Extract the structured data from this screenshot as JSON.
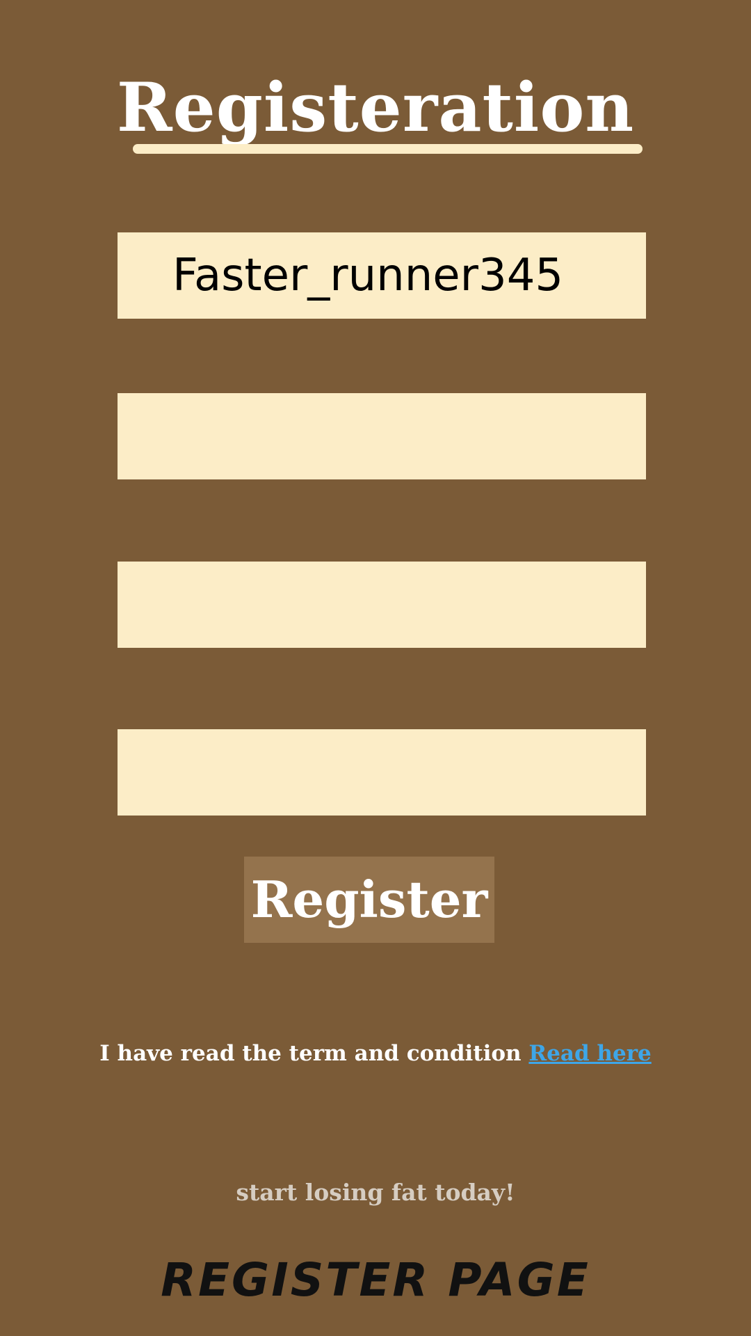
{
  "header": {
    "title": "Registeration"
  },
  "form": {
    "username_value": "Faster_runner345",
    "field2_value": "",
    "field3_value": "",
    "field4_value": "",
    "register_label": "Register"
  },
  "terms": {
    "text": "I have read the term and condition",
    "link_label": "Read here"
  },
  "footer": {
    "tagline": "start losing fat today!",
    "page_title": "REGISTER PAGE"
  },
  "colors": {
    "background": "#7b5b37",
    "field": "#fcedc7",
    "button": "#94734d",
    "link": "#3ea6e8"
  }
}
